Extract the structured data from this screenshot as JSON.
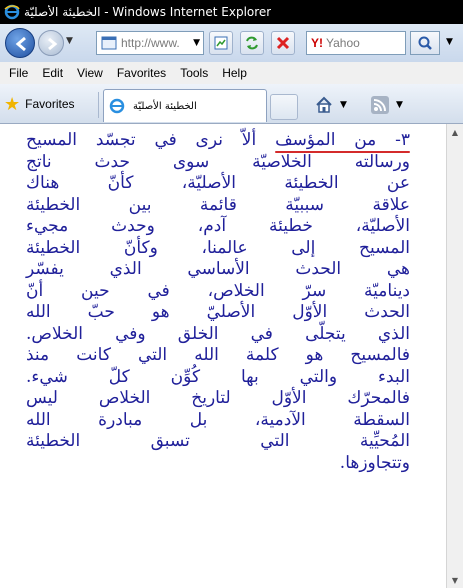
{
  "window": {
    "title": "الخطيئة الأصليّة - Windows Internet Explorer"
  },
  "address": {
    "url": "http://www.",
    "search_placeholder": "Yahoo",
    "search_brand": "Y!"
  },
  "menu": [
    "File",
    "Edit",
    "View",
    "Favorites",
    "Tools",
    "Help"
  ],
  "favorites": {
    "label": "Favorites",
    "tab_title": "الخطيئة الأصليّة"
  },
  "article": {
    "lead": "٣- من المؤسف",
    "lines": [
      "ألاّ نرى في تجسّد المسيح",
      "ورسالته الخلاصيّة سوى حدث ناتج",
      "عن الخطيئة الأصليّة، كأنّ هناك",
      "علاقة سببيّة قائمة بين الخطيئة",
      "الأصليّة، خطيئة آدم، وحدث مجيء",
      "المسيح إلى عالمنا، وكأنّ الخطيئة",
      "هي الحدث الأساسي الذي يفسّر",
      "ديناميّة سرّ الخلاص، في حين أنّ",
      "الحدث الأوّل الأصليّ هو حبّ الله",
      "الذي يتجلّى في الخلق وفي الخلاص.",
      "فالمسيح هو كلمة الله التي كانت منذ",
      "البدء والتي بها كُوِّن كلّ شيء.",
      "فالمحرّك الأوّل لتاريخ الخلاص ليس",
      "السقطة الآدمية، بل مبادرة الله",
      "المُحيِّية التي تسبق الخطيئة",
      "وتتجاوزها."
    ]
  },
  "colors": {
    "text": "#20209a",
    "underline": "#d42b2b"
  }
}
